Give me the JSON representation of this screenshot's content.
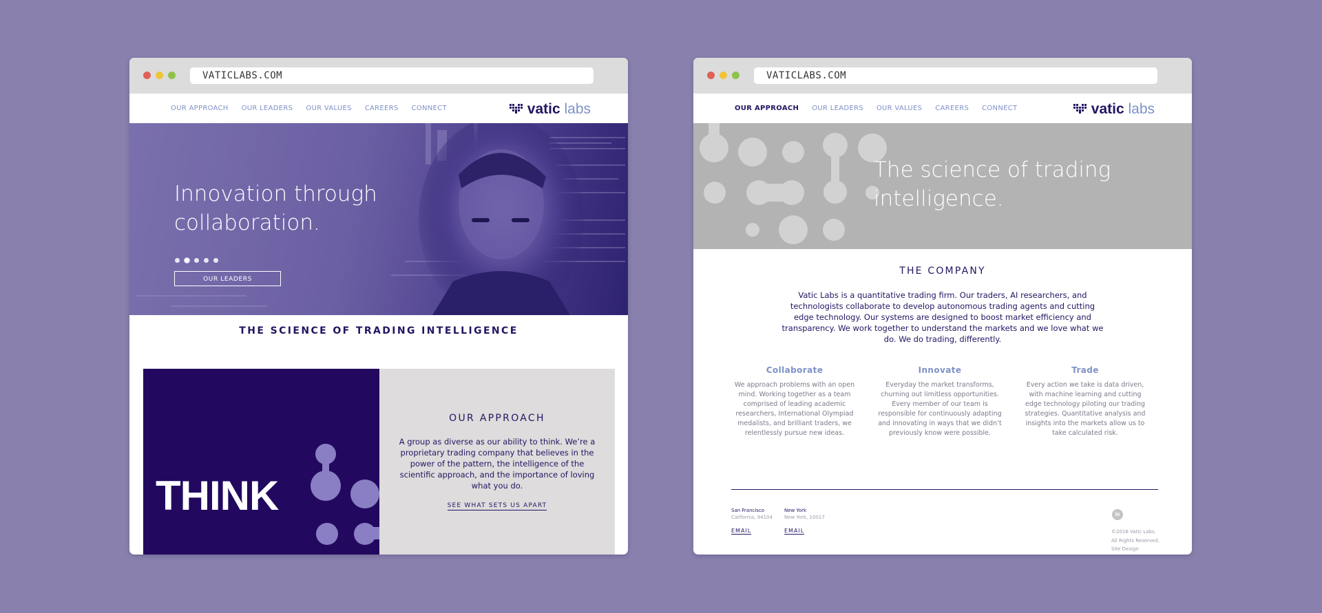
{
  "colors": {
    "background": "#8980ad",
    "brand_dark": "#221562",
    "brand_light": "#7f92c6",
    "hero_purple": "#6b5fa3",
    "banner_gray": "#b4b3b4",
    "think_navy": "#22095f",
    "approach_gray": "#dedcdc"
  },
  "left": {
    "url": "VATICLABS.COM",
    "nav": [
      "OUR APPROACH",
      "OUR LEADERS",
      "OUR VALUES",
      "CAREERS",
      "CONNECT"
    ],
    "logo": {
      "part1": "vatic",
      "part2": " labs",
      "icon": "pixel-heart-icon"
    },
    "hero": {
      "title": "Innovation through collaboration.",
      "button": "OUR LEADERS",
      "slides_total": 5,
      "active_slide": 2
    },
    "tagline": "THE SCIENCE OF TRADING INTELLIGENCE",
    "think": {
      "word": "THINK"
    },
    "approach": {
      "title": "OUR APPROACH",
      "body": "A group as diverse as our ability to think. We’re a proprietary trading company that believes in the power of the pattern, the intelligence of the scientific approach, and the importance of loving what you do.",
      "link": "SEE WHAT SETS US APART"
    }
  },
  "right": {
    "url": "VATICLABS.COM",
    "nav": [
      "OUR APPROACH",
      "OUR LEADERS",
      "OUR VALUES",
      "CAREERS",
      "CONNECT"
    ],
    "nav_active": "OUR APPROACH",
    "logo": {
      "part1": "vatic",
      "part2": " labs",
      "icon": "pixel-heart-icon"
    },
    "banner_title": "The science of trading intelligence.",
    "company": {
      "title": "THE COMPANY",
      "body": "Vatic Labs is a quantitative trading firm. Our traders, AI researchers, and technologists collaborate to develop autonomous trading agents and cutting edge technology. Our systems are designed to boost market efficiency and transparency. We work together to understand the markets and we love what we do. We do trading, differently."
    },
    "columns": [
      {
        "title": "Collaborate",
        "body": "We approach problems with an open mind. Working together as a team comprised of leading academic researchers, International Olympiad medalists, and brilliant traders, we relentlessly pursue new ideas."
      },
      {
        "title": "Innovate",
        "body": "Everyday the market transforms, churning out limitless opportunities. Every member of our team is responsible for continuously adapting and innovating in ways that we didn’t previously know were possible."
      },
      {
        "title": "Trade",
        "body": "Every action we take is data driven, with machine learning and cutting edge technology piloting our trading strategies. Quantitative analysis and insights into the markets allow us to take calculated risk."
      }
    ],
    "footer": {
      "offices": [
        {
          "city": "San Francisco",
          "address": "California, 94104",
          "email": "EMAIL"
        },
        {
          "city": "New York",
          "address": "New York, 10017",
          "email": "EMAIL"
        }
      ],
      "social_icon": "linkedin-icon",
      "social_label": "in",
      "copyright": [
        "©2016 Vatic Labs.",
        "All Rights Reserved.",
        "Site Design"
      ]
    }
  }
}
